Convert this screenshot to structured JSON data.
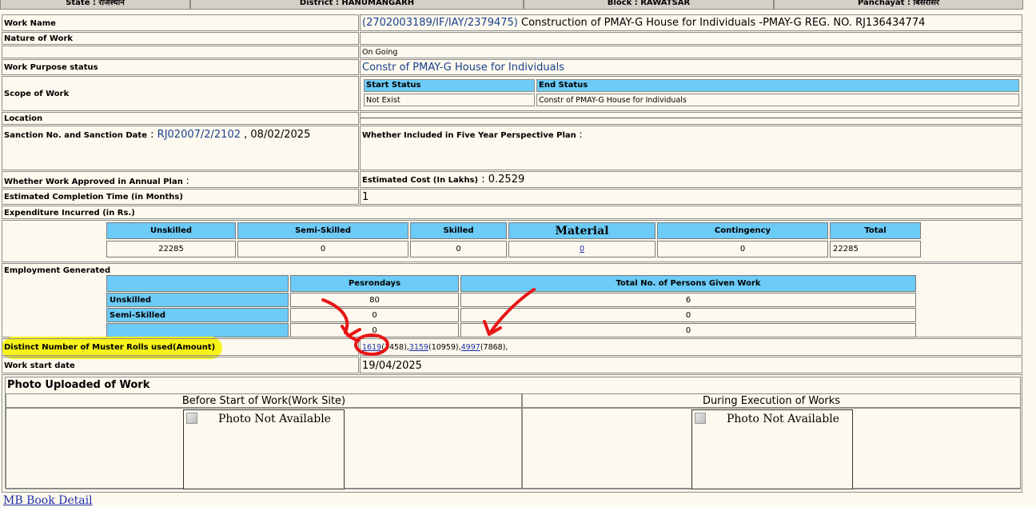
{
  "header": {
    "state": "State : राजस्थान",
    "district": "District : HANUMANGARH",
    "block": "Block : RAWATSAR",
    "panchayat": "Panchayat : बिसरासर"
  },
  "work_name": {
    "label": "Work Name",
    "code": "(2702003189/IF/IAY/2379475)",
    "text": " Construction of PMAY-G House for Individuals -PMAY-G REG. NO. RJ136434774"
  },
  "nature_of_work": {
    "label": "Nature of Work",
    "value": "On Going"
  },
  "work_purpose": {
    "label": "Work Purpose status",
    "value": "Constr of PMAY-G House for Individuals"
  },
  "scope": {
    "label": "Scope of Work",
    "start_header": "Start Status",
    "end_header": "End Status",
    "start_value": "Not Exist",
    "end_value": "Constr of PMAY-G House for Individuals"
  },
  "location": {
    "label": "Location"
  },
  "sanction": {
    "label": "Sanction No. and Sanction Date",
    "sep": " : ",
    "number": "RJ02007/2/2102",
    "comma": " , ",
    "date": "08/02/2025"
  },
  "five_year": {
    "label": "Whether Included in Five Year Perspective Plan",
    "sep": " :"
  },
  "annual_plan": {
    "label": "Whether Work Approved in Annual Plan",
    "sep": " :"
  },
  "estimated_cost": {
    "label": "Estimated Cost (In Lakhs)",
    "sep": " : ",
    "value": "0.2529"
  },
  "completion_time": {
    "label": "Estimated Completion Time (in Months)",
    "value": "1"
  },
  "expenditure": {
    "label": "Expenditure Incurred (in Rs.)",
    "headers": [
      "Unskilled",
      "Semi-Skilled",
      "Skilled",
      "Material",
      "Contingency",
      "Total"
    ],
    "values": [
      "22285",
      "0",
      "0",
      "0",
      "0",
      "22285"
    ]
  },
  "employment": {
    "label": "Employment Generated",
    "header_blank": "",
    "header_persondays": "Pesrondays",
    "header_persons": "Total No. of Persons Given Work",
    "rows": [
      {
        "name": "Unskilled",
        "persondays": "80",
        "persons": "6"
      },
      {
        "name": "Semi-Skilled",
        "persondays": "0",
        "persons": "0"
      },
      {
        "name": "",
        "persondays": "0",
        "persons": "0"
      }
    ]
  },
  "muster_rolls": {
    "label": "Distinct Number of Muster Rolls used(Amount)",
    "items": [
      {
        "number": "1619",
        "amount": "(3458),"
      },
      {
        "number": "3159",
        "amount": "(10959),"
      },
      {
        "number": "4997",
        "amount": "(7868),"
      }
    ]
  },
  "work_start": {
    "label": "Work start date",
    "value": "19/04/2025"
  },
  "photos": {
    "title": "Photo Uploaded of Work",
    "before_label": "Before Start of Work(Work Site)",
    "during_label": "During Execution of Works",
    "before_alt": "Photo Not Available",
    "during_alt": "Photo Not Available"
  },
  "footer_link": "MB Book Detail",
  "colors": {
    "header_cell": "#6ccbf7",
    "page_bg": "#fdf9ee",
    "link": "#1f2fae",
    "annotation": "#e81515",
    "highlight": "#f7f21a"
  }
}
